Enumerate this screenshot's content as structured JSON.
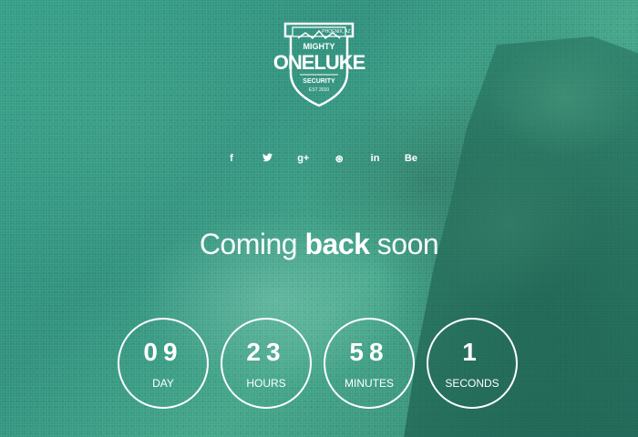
{
  "logo": {
    "top_text": "PHOENIX, AZ",
    "mighty": "MIGHTY",
    "name": "ONELUKE",
    "security": "SECURITY",
    "est": "EST 2010"
  },
  "social": [
    {
      "icon": "facebook-icon",
      "glyph": "f"
    },
    {
      "icon": "twitter-icon",
      "glyph": "🐦"
    },
    {
      "icon": "google-plus-icon",
      "glyph": "g+"
    },
    {
      "icon": "dribbble-icon",
      "glyph": "⊛"
    },
    {
      "icon": "linkedin-icon",
      "glyph": "in"
    },
    {
      "icon": "behance-icon",
      "glyph": "Be"
    }
  ],
  "headline": {
    "before": "Coming ",
    "bold": "back",
    "after": " soon"
  },
  "countdown": [
    {
      "value": "09",
      "label": "DAY"
    },
    {
      "value": "23",
      "label": "HOURS"
    },
    {
      "value": "58",
      "label": "MINUTES"
    },
    {
      "value": "1",
      "label": "SECONDS"
    }
  ],
  "colors": {
    "accent": "#ffffff",
    "background": "#2f9c84"
  }
}
